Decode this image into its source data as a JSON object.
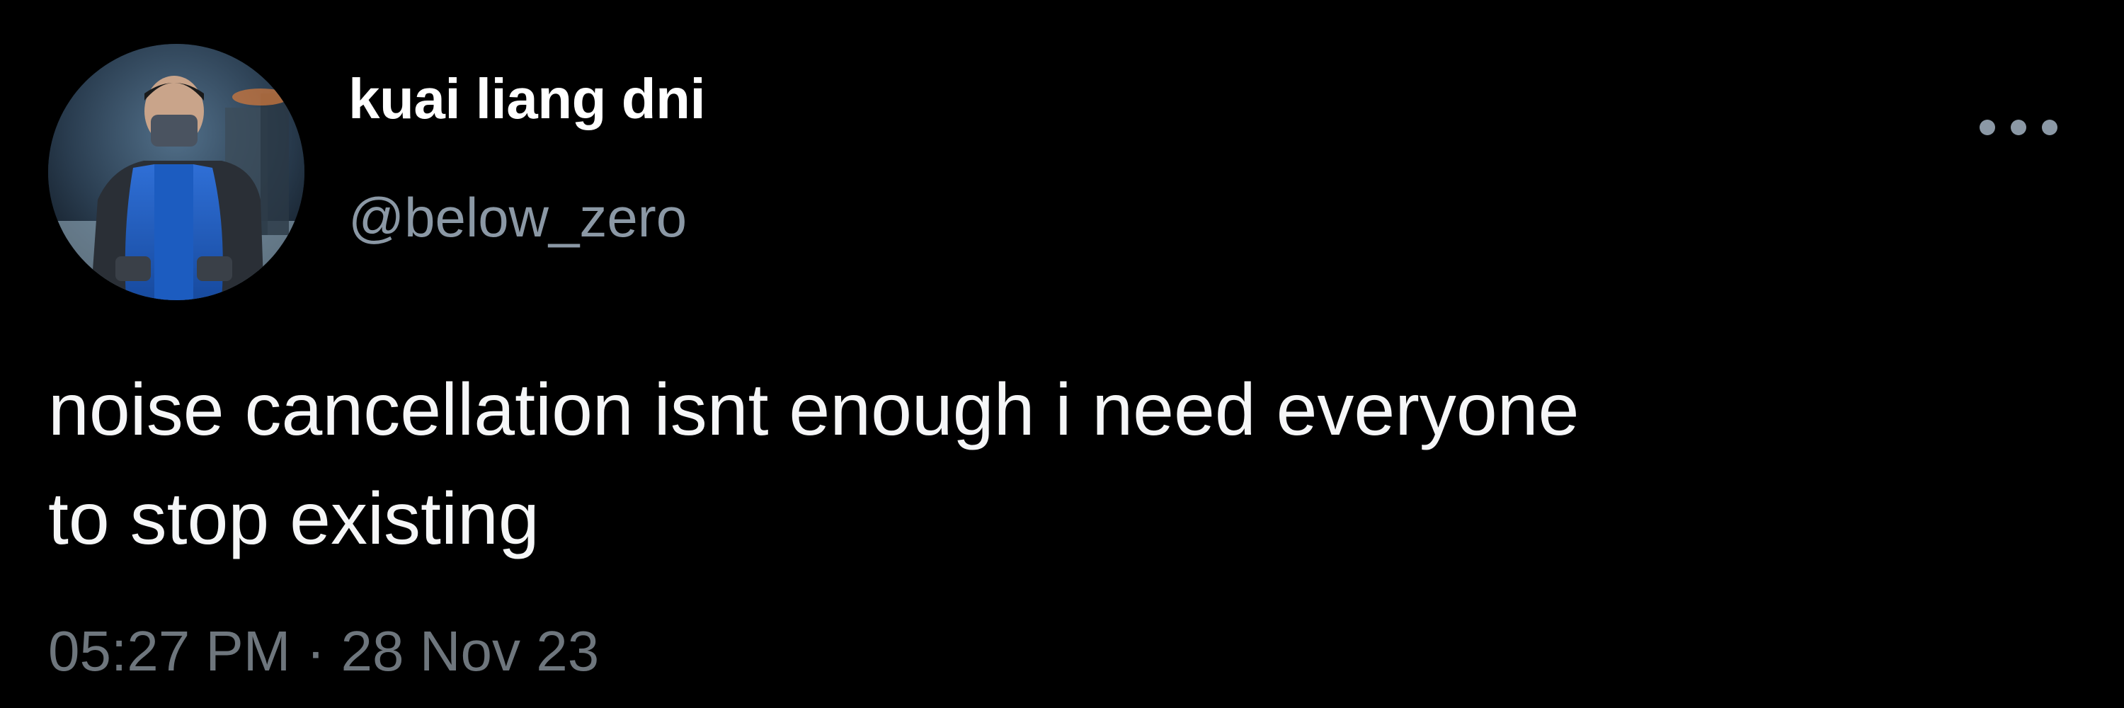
{
  "tweet": {
    "display_name": "kuai liang dni",
    "handle": "@below_zero",
    "text": "noise cancellation isnt enough i need everyone\nto stop existing",
    "timestamp": "05:27 PM · 28 Nov 23",
    "more_icon": "more-horizontal-icon"
  },
  "colors": {
    "background": "#000000",
    "primary_text": "#ffffff",
    "secondary_text": "#8b98a5",
    "timestamp_text": "#6e767d"
  }
}
